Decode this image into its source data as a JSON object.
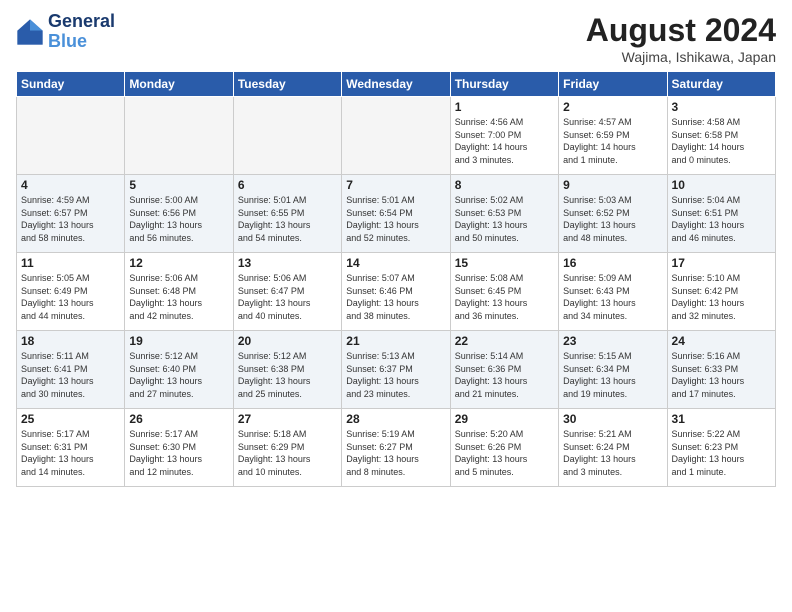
{
  "logo": {
    "line1": "General",
    "line2": "Blue"
  },
  "title": "August 2024",
  "location": "Wajima, Ishikawa, Japan",
  "days_of_week": [
    "Sunday",
    "Monday",
    "Tuesday",
    "Wednesday",
    "Thursday",
    "Friday",
    "Saturday"
  ],
  "weeks": [
    [
      {
        "day": "",
        "info": ""
      },
      {
        "day": "",
        "info": ""
      },
      {
        "day": "",
        "info": ""
      },
      {
        "day": "",
        "info": ""
      },
      {
        "day": "1",
        "info": "Sunrise: 4:56 AM\nSunset: 7:00 PM\nDaylight: 14 hours\nand 3 minutes."
      },
      {
        "day": "2",
        "info": "Sunrise: 4:57 AM\nSunset: 6:59 PM\nDaylight: 14 hours\nand 1 minute."
      },
      {
        "day": "3",
        "info": "Sunrise: 4:58 AM\nSunset: 6:58 PM\nDaylight: 14 hours\nand 0 minutes."
      }
    ],
    [
      {
        "day": "4",
        "info": "Sunrise: 4:59 AM\nSunset: 6:57 PM\nDaylight: 13 hours\nand 58 minutes."
      },
      {
        "day": "5",
        "info": "Sunrise: 5:00 AM\nSunset: 6:56 PM\nDaylight: 13 hours\nand 56 minutes."
      },
      {
        "day": "6",
        "info": "Sunrise: 5:01 AM\nSunset: 6:55 PM\nDaylight: 13 hours\nand 54 minutes."
      },
      {
        "day": "7",
        "info": "Sunrise: 5:01 AM\nSunset: 6:54 PM\nDaylight: 13 hours\nand 52 minutes."
      },
      {
        "day": "8",
        "info": "Sunrise: 5:02 AM\nSunset: 6:53 PM\nDaylight: 13 hours\nand 50 minutes."
      },
      {
        "day": "9",
        "info": "Sunrise: 5:03 AM\nSunset: 6:52 PM\nDaylight: 13 hours\nand 48 minutes."
      },
      {
        "day": "10",
        "info": "Sunrise: 5:04 AM\nSunset: 6:51 PM\nDaylight: 13 hours\nand 46 minutes."
      }
    ],
    [
      {
        "day": "11",
        "info": "Sunrise: 5:05 AM\nSunset: 6:49 PM\nDaylight: 13 hours\nand 44 minutes."
      },
      {
        "day": "12",
        "info": "Sunrise: 5:06 AM\nSunset: 6:48 PM\nDaylight: 13 hours\nand 42 minutes."
      },
      {
        "day": "13",
        "info": "Sunrise: 5:06 AM\nSunset: 6:47 PM\nDaylight: 13 hours\nand 40 minutes."
      },
      {
        "day": "14",
        "info": "Sunrise: 5:07 AM\nSunset: 6:46 PM\nDaylight: 13 hours\nand 38 minutes."
      },
      {
        "day": "15",
        "info": "Sunrise: 5:08 AM\nSunset: 6:45 PM\nDaylight: 13 hours\nand 36 minutes."
      },
      {
        "day": "16",
        "info": "Sunrise: 5:09 AM\nSunset: 6:43 PM\nDaylight: 13 hours\nand 34 minutes."
      },
      {
        "day": "17",
        "info": "Sunrise: 5:10 AM\nSunset: 6:42 PM\nDaylight: 13 hours\nand 32 minutes."
      }
    ],
    [
      {
        "day": "18",
        "info": "Sunrise: 5:11 AM\nSunset: 6:41 PM\nDaylight: 13 hours\nand 30 minutes."
      },
      {
        "day": "19",
        "info": "Sunrise: 5:12 AM\nSunset: 6:40 PM\nDaylight: 13 hours\nand 27 minutes."
      },
      {
        "day": "20",
        "info": "Sunrise: 5:12 AM\nSunset: 6:38 PM\nDaylight: 13 hours\nand 25 minutes."
      },
      {
        "day": "21",
        "info": "Sunrise: 5:13 AM\nSunset: 6:37 PM\nDaylight: 13 hours\nand 23 minutes."
      },
      {
        "day": "22",
        "info": "Sunrise: 5:14 AM\nSunset: 6:36 PM\nDaylight: 13 hours\nand 21 minutes."
      },
      {
        "day": "23",
        "info": "Sunrise: 5:15 AM\nSunset: 6:34 PM\nDaylight: 13 hours\nand 19 minutes."
      },
      {
        "day": "24",
        "info": "Sunrise: 5:16 AM\nSunset: 6:33 PM\nDaylight: 13 hours\nand 17 minutes."
      }
    ],
    [
      {
        "day": "25",
        "info": "Sunrise: 5:17 AM\nSunset: 6:31 PM\nDaylight: 13 hours\nand 14 minutes."
      },
      {
        "day": "26",
        "info": "Sunrise: 5:17 AM\nSunset: 6:30 PM\nDaylight: 13 hours\nand 12 minutes."
      },
      {
        "day": "27",
        "info": "Sunrise: 5:18 AM\nSunset: 6:29 PM\nDaylight: 13 hours\nand 10 minutes."
      },
      {
        "day": "28",
        "info": "Sunrise: 5:19 AM\nSunset: 6:27 PM\nDaylight: 13 hours\nand 8 minutes."
      },
      {
        "day": "29",
        "info": "Sunrise: 5:20 AM\nSunset: 6:26 PM\nDaylight: 13 hours\nand 5 minutes."
      },
      {
        "day": "30",
        "info": "Sunrise: 5:21 AM\nSunset: 6:24 PM\nDaylight: 13 hours\nand 3 minutes."
      },
      {
        "day": "31",
        "info": "Sunrise: 5:22 AM\nSunset: 6:23 PM\nDaylight: 13 hours\nand 1 minute."
      }
    ]
  ]
}
